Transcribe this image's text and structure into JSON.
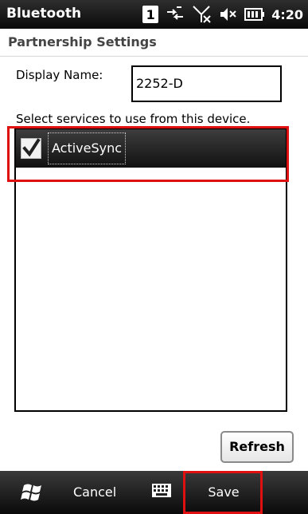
{
  "status_bar": {
    "app_name": "Bluetooth",
    "notification_count": "1",
    "time": "4:20",
    "icons": [
      "notification-badge-icon",
      "data-connection-icon",
      "signal-off-icon",
      "volume-off-icon",
      "battery-icon"
    ]
  },
  "header": {
    "title": "Partnership Settings"
  },
  "form": {
    "display_name_label": "Display Name:",
    "display_name_value": "2252-D",
    "services_label": "Select services to use from this device.",
    "services": [
      {
        "label": "ActiveSync",
        "checked": true
      }
    ],
    "refresh_label": "Refresh"
  },
  "softkeys": {
    "start_icon": "windows-logo-icon",
    "cancel_label": "Cancel",
    "keyboard_icon": "keyboard-icon",
    "save_label": "Save"
  },
  "colors": {
    "highlight": "#e01010",
    "bar_dark": "#111111"
  }
}
